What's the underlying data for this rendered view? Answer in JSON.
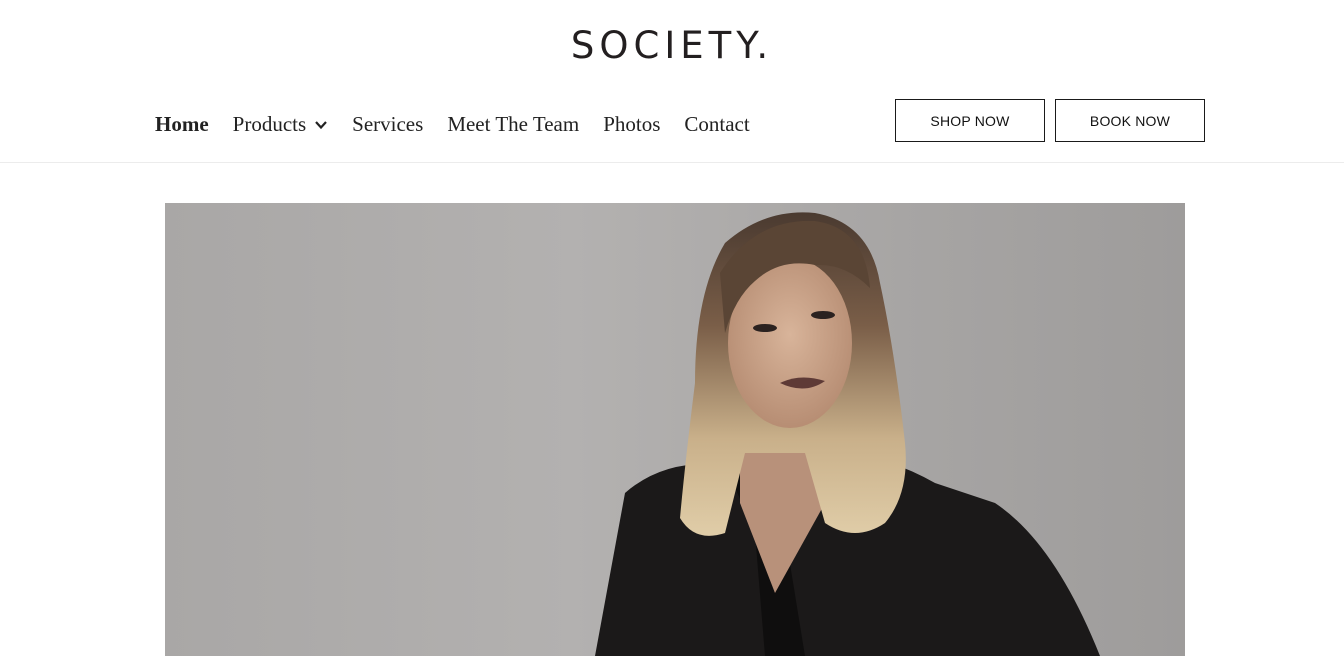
{
  "brand": {
    "logo_text": "SOCIETY."
  },
  "nav": {
    "items": [
      {
        "label": "Home",
        "active": true
      },
      {
        "label": "Products",
        "has_dropdown": true
      },
      {
        "label": "Services"
      },
      {
        "label": "Meet The Team"
      },
      {
        "label": "Photos"
      },
      {
        "label": "Contact"
      }
    ]
  },
  "actions": {
    "shop_label": "SHOP NOW",
    "book_label": "BOOK NOW"
  },
  "hero": {
    "image_subject": "woman-portrait-photo",
    "icons": [
      "chevron-down-icon"
    ]
  }
}
